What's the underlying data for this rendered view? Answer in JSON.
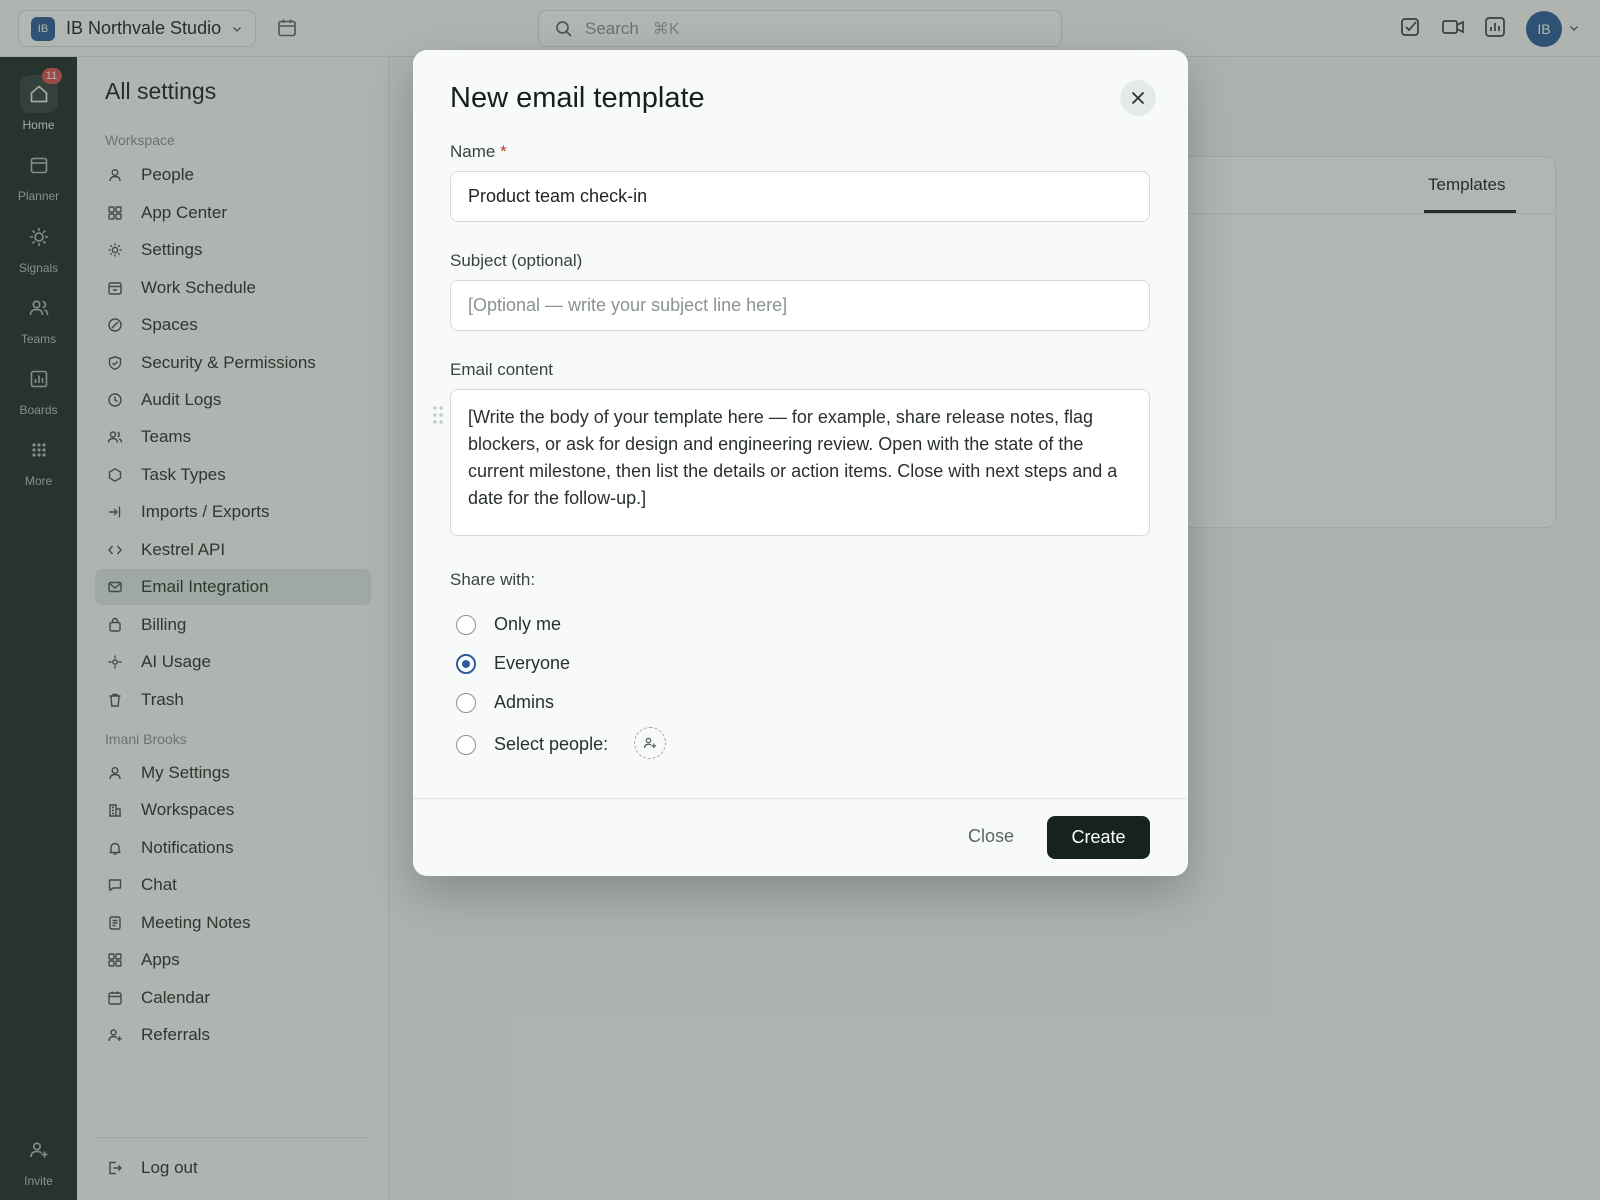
{
  "topbar": {
    "workspace_initials": "IB",
    "workspace_name": "IB Northvale Studio",
    "search_placeholder": "Search",
    "search_shortcut": "⌘K",
    "avatar_initials": "IB"
  },
  "rail": {
    "items": [
      {
        "label": "Home",
        "icon": "home-icon",
        "badge": "11",
        "active": true
      },
      {
        "label": "Planner",
        "icon": "calendar-icon"
      },
      {
        "label": "Signals",
        "icon": "sun-icon"
      },
      {
        "label": "Teams",
        "icon": "users-icon"
      },
      {
        "label": "Boards",
        "icon": "chart-icon"
      },
      {
        "label": "More",
        "icon": "grid-icon"
      }
    ],
    "invite_label": "Invite"
  },
  "settings": {
    "title": "All settings",
    "workspace_section": "Workspace",
    "workspace_items": [
      {
        "label": "People",
        "icon": "person-icon"
      },
      {
        "label": "App Center",
        "icon": "apps-icon"
      },
      {
        "label": "Settings",
        "icon": "gear-icon"
      },
      {
        "label": "Work Schedule",
        "icon": "schedule-icon"
      },
      {
        "label": "Spaces",
        "icon": "compass-icon"
      },
      {
        "label": "Security & Permissions",
        "icon": "shield-icon"
      },
      {
        "label": "Audit Logs",
        "icon": "clock-icon"
      },
      {
        "label": "Teams",
        "icon": "team-icon"
      },
      {
        "label": "Task Types",
        "icon": "hexagon-icon"
      },
      {
        "label": "Imports / Exports",
        "icon": "import-icon"
      },
      {
        "label": "Kestrel API",
        "icon": "code-icon"
      },
      {
        "label": "Email Integration",
        "icon": "mail-icon",
        "active": true
      },
      {
        "label": "Billing",
        "icon": "wallet-icon"
      },
      {
        "label": "AI Usage",
        "icon": "sparkle-icon"
      },
      {
        "label": "Trash",
        "icon": "trash-icon"
      }
    ],
    "user_section": "Imani Brooks",
    "user_items": [
      {
        "label": "My Settings",
        "icon": "person-icon"
      },
      {
        "label": "Workspaces",
        "icon": "building-icon"
      },
      {
        "label": "Notifications",
        "icon": "bell-icon"
      },
      {
        "label": "Chat",
        "icon": "chat-icon"
      },
      {
        "label": "Meeting Notes",
        "icon": "notes-icon"
      },
      {
        "label": "Apps",
        "icon": "apps-icon"
      },
      {
        "label": "Calendar",
        "icon": "calendar-icon"
      },
      {
        "label": "Referrals",
        "icon": "referral-icon"
      }
    ],
    "logout_label": "Log out"
  },
  "background": {
    "active_tab": "Templates"
  },
  "modal": {
    "title": "New email template",
    "name_label": "Name",
    "name_required": "*",
    "name_value": "Product team check-in",
    "subject_label": "Subject (optional)",
    "subject_placeholder": "[Optional — write your subject line here]",
    "content_label": "Email content",
    "content_value": "[Write the body of your template here — for example, share release notes, flag blockers, or ask for design and engineering review. Open with the state of the current milestone, then list the details or action items. Close with next steps and a date for the follow-up.]",
    "share_label": "Share with:",
    "share_options": [
      {
        "label": "Only me",
        "checked": false
      },
      {
        "label": "Everyone",
        "checked": true
      },
      {
        "label": "Admins",
        "checked": false
      },
      {
        "label": "Select people:",
        "checked": false
      }
    ],
    "close_label": "Close",
    "create_label": "Create"
  },
  "colors": {
    "rail_bg": "#1f2d27",
    "accent": "#2b5d9a",
    "primary_button": "#16231d",
    "badge": "#d9534f",
    "active_nav": "#e3e9e5"
  }
}
